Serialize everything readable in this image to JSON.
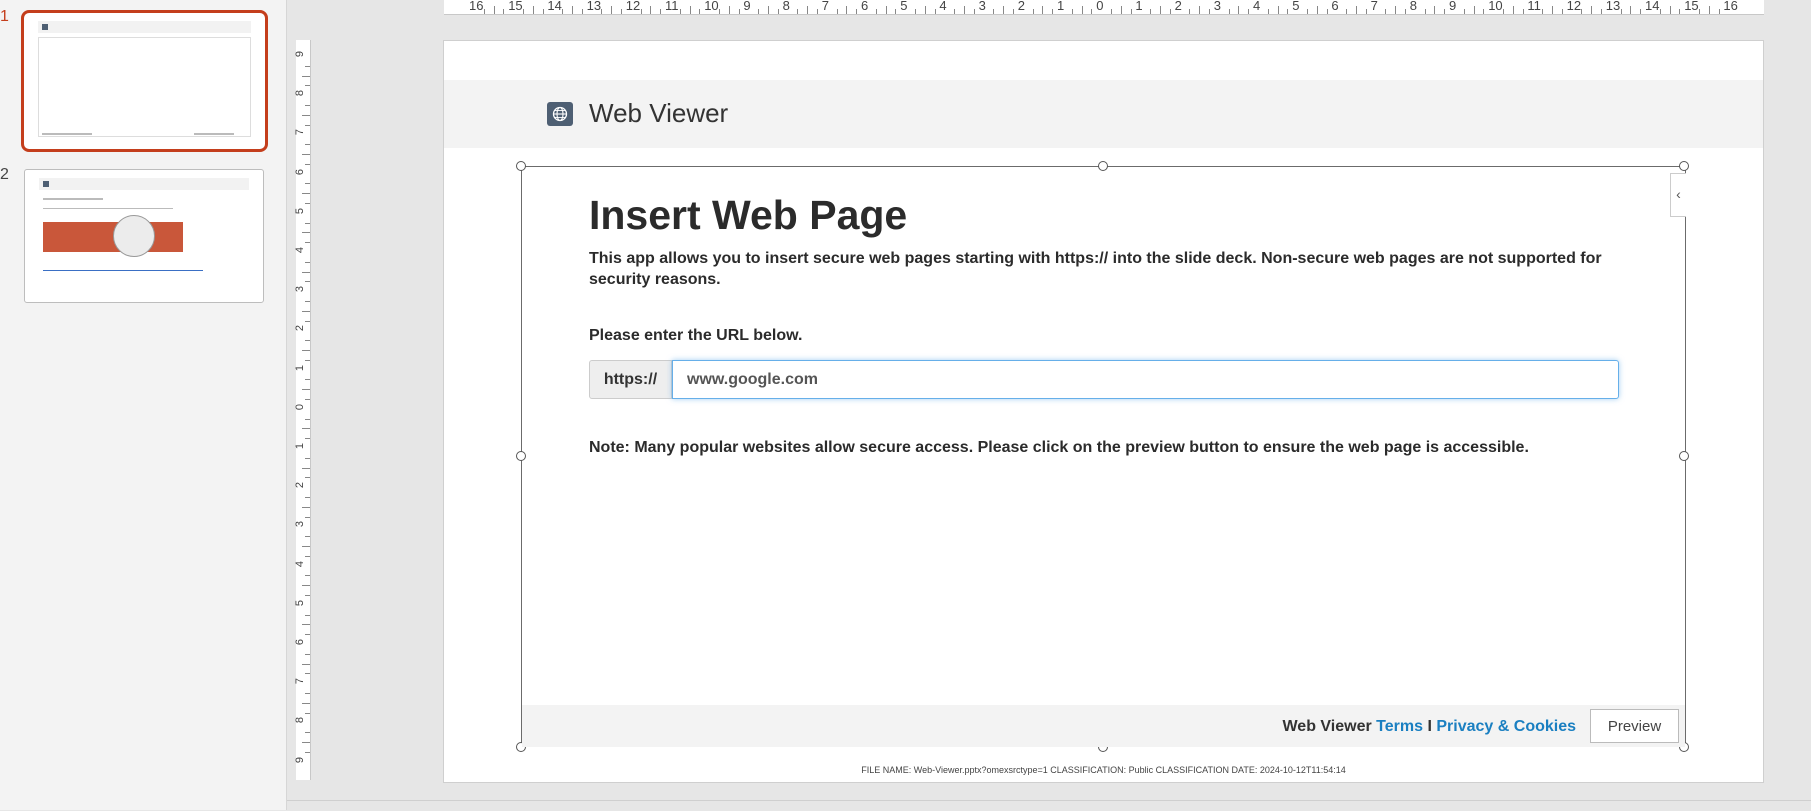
{
  "thumbnails": [
    {
      "number": "1",
      "active": true
    },
    {
      "number": "2",
      "active": false
    }
  ],
  "ruler": {
    "top_labels": [
      "16",
      "15",
      "14",
      "13",
      "12",
      "11",
      "10",
      "9",
      "8",
      "7",
      "6",
      "5",
      "4",
      "3",
      "2",
      "1",
      "0",
      "1",
      "2",
      "3",
      "4",
      "5",
      "6",
      "7",
      "8",
      "9",
      "10",
      "11",
      "12",
      "13",
      "14",
      "15",
      "16"
    ],
    "left_labels": [
      "9",
      "8",
      "7",
      "6",
      "5",
      "4",
      "3",
      "2",
      "1",
      "0",
      "1",
      "2",
      "3",
      "4",
      "5",
      "6",
      "7",
      "8",
      "9"
    ]
  },
  "slide": {
    "app_title": "Web Viewer",
    "page_title": "Insert Web Page",
    "intro": "This app allows you to insert secure web pages starting with https:// into the slide deck. Non-secure web pages are not supported for security reasons.",
    "url_prompt": "Please enter the URL below.",
    "url_prefix": "https://",
    "url_value": "www.google.com",
    "note": "Note: Many popular websites allow secure access. Please click on the preview button to ensure the web page is accessible.",
    "footer": {
      "brand": "Web Viewer",
      "terms": "Terms",
      "separator": "I",
      "privacy": "Privacy & Cookies",
      "preview_label": "Preview"
    },
    "classification": "FILE NAME: Web-Viewer.pptx?omexsrctype=1  CLASSIFICATION: Public  CLASSIFICATION DATE: 2024-10-12T11:54:14"
  },
  "colors": {
    "accent_selection": "#c43e1c",
    "link": "#1a7fc1",
    "input_focus": "#66afe9",
    "icon_bg": "#4e5f73"
  },
  "icons": {
    "globe": "globe-icon",
    "collapse": "chevron-left-icon"
  }
}
